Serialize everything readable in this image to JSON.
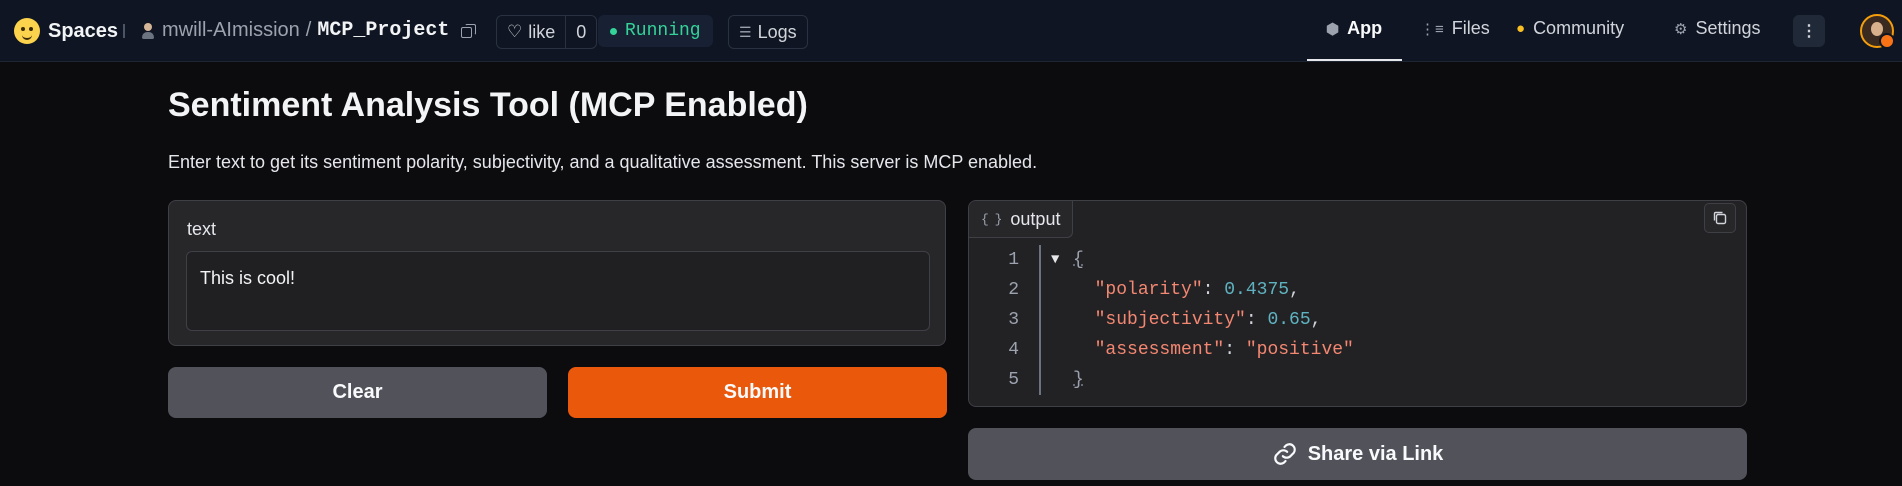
{
  "topbar": {
    "spaces_label": "Spaces",
    "repo_owner": "mwill-AImission",
    "repo_separator": "/",
    "repo_name": "MCP_Project",
    "like_label": "like",
    "like_count": "0",
    "status": "Running",
    "status_color": "#34d399",
    "logs_label": "Logs",
    "tabs": [
      {
        "label": "App",
        "icon": "cube-icon",
        "active": true
      },
      {
        "label": "Files",
        "icon": "files-icon",
        "active": false
      },
      {
        "label": "Community",
        "icon": "community-icon",
        "active": false
      },
      {
        "label": "Settings",
        "icon": "gear-icon",
        "active": false
      }
    ]
  },
  "main": {
    "title": "Sentiment Analysis Tool (MCP Enabled)",
    "description": "Enter text to get its sentiment polarity, subjectivity, and a qualitative assessment. This server is MCP enabled.",
    "input": {
      "label": "text",
      "value": "This is cool!"
    },
    "buttons": {
      "clear_label": "Clear",
      "submit_label": "Submit",
      "submit_color": "#ea580c"
    },
    "output": {
      "label": "output",
      "lines": [
        {
          "num": "1",
          "open": "{"
        },
        {
          "num": "2",
          "key": "\"polarity\"",
          "value": "0.4375",
          "type": "num",
          "comma": ","
        },
        {
          "num": "3",
          "key": "\"subjectivity\"",
          "value": "0.65",
          "type": "num",
          "comma": ","
        },
        {
          "num": "4",
          "key": "\"assessment\"",
          "value": "\"positive\"",
          "type": "str",
          "comma": ""
        },
        {
          "num": "5",
          "close": "}"
        }
      ]
    },
    "share_label": "Share via Link"
  }
}
